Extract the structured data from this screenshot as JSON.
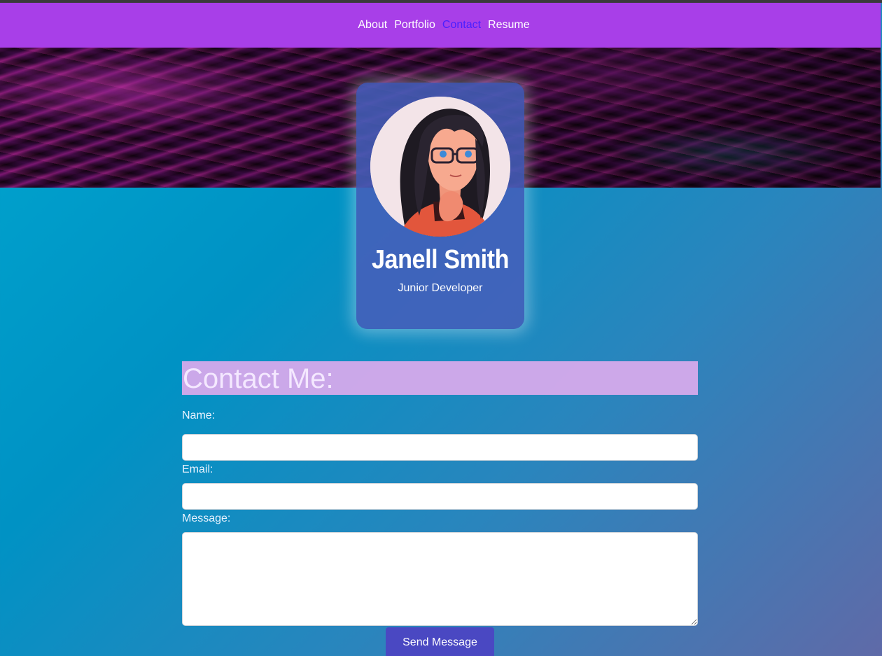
{
  "nav": {
    "items": [
      {
        "label": "About"
      },
      {
        "label": "Portfolio"
      },
      {
        "label": "Contact",
        "active": true
      },
      {
        "label": "Resume"
      }
    ]
  },
  "profile": {
    "name": "Janell Smith",
    "title": "Junior Developer"
  },
  "contact": {
    "heading": "Contact Me:",
    "name_label": "Name:",
    "name_value": "",
    "email_label": "Email:",
    "email_value": "",
    "message_label": "Message:",
    "message_value": "",
    "submit_label": "Send Message"
  },
  "colors": {
    "navbar": "#a83fe8",
    "active_link": "#4a1fff",
    "card": "#465fb9",
    "heading_bg": "#d6aaeb",
    "button": "#4a48c2"
  }
}
